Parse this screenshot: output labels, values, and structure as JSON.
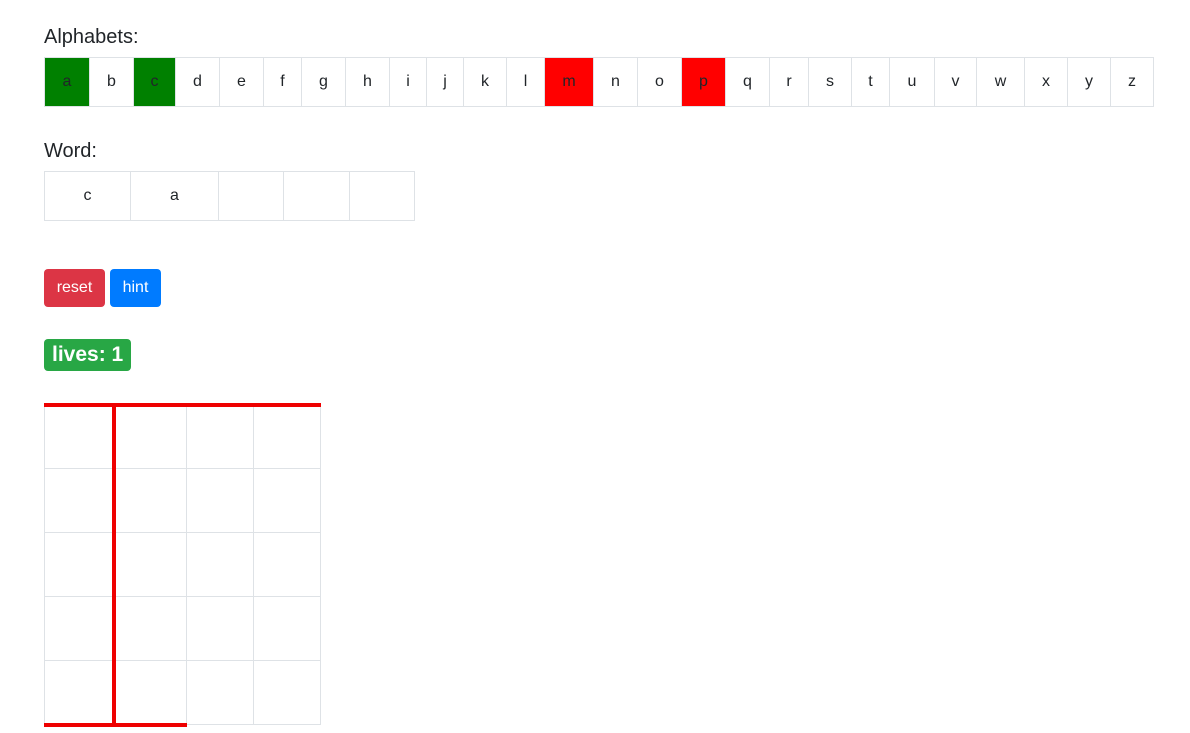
{
  "alphabets": {
    "label": "Alphabets:",
    "letters": [
      {
        "char": "a",
        "state": "correct"
      },
      {
        "char": "b",
        "state": "none"
      },
      {
        "char": "c",
        "state": "correct"
      },
      {
        "char": "d",
        "state": "none"
      },
      {
        "char": "e",
        "state": "none"
      },
      {
        "char": "f",
        "state": "none"
      },
      {
        "char": "g",
        "state": "none"
      },
      {
        "char": "h",
        "state": "none"
      },
      {
        "char": "i",
        "state": "none"
      },
      {
        "char": "j",
        "state": "none"
      },
      {
        "char": "k",
        "state": "none"
      },
      {
        "char": "l",
        "state": "none"
      },
      {
        "char": "m",
        "state": "wrong"
      },
      {
        "char": "n",
        "state": "none"
      },
      {
        "char": "o",
        "state": "none"
      },
      {
        "char": "p",
        "state": "wrong"
      },
      {
        "char": "q",
        "state": "none"
      },
      {
        "char": "r",
        "state": "none"
      },
      {
        "char": "s",
        "state": "none"
      },
      {
        "char": "t",
        "state": "none"
      },
      {
        "char": "u",
        "state": "none"
      },
      {
        "char": "v",
        "state": "none"
      },
      {
        "char": "w",
        "state": "none"
      },
      {
        "char": "x",
        "state": "none"
      },
      {
        "char": "y",
        "state": "none"
      },
      {
        "char": "z",
        "state": "none"
      }
    ]
  },
  "word": {
    "label": "Word:",
    "slots": [
      "c",
      "a",
      "",
      "",
      ""
    ]
  },
  "buttons": {
    "reset_label": "reset",
    "hint_label": "hint"
  },
  "lives": {
    "text": "lives: 1"
  },
  "colors": {
    "correct": "#008000",
    "wrong": "#ff0000",
    "reset": "#dc3545",
    "hint": "#007bff",
    "lives_badge": "#28a745",
    "gallows": "#ee0000"
  }
}
